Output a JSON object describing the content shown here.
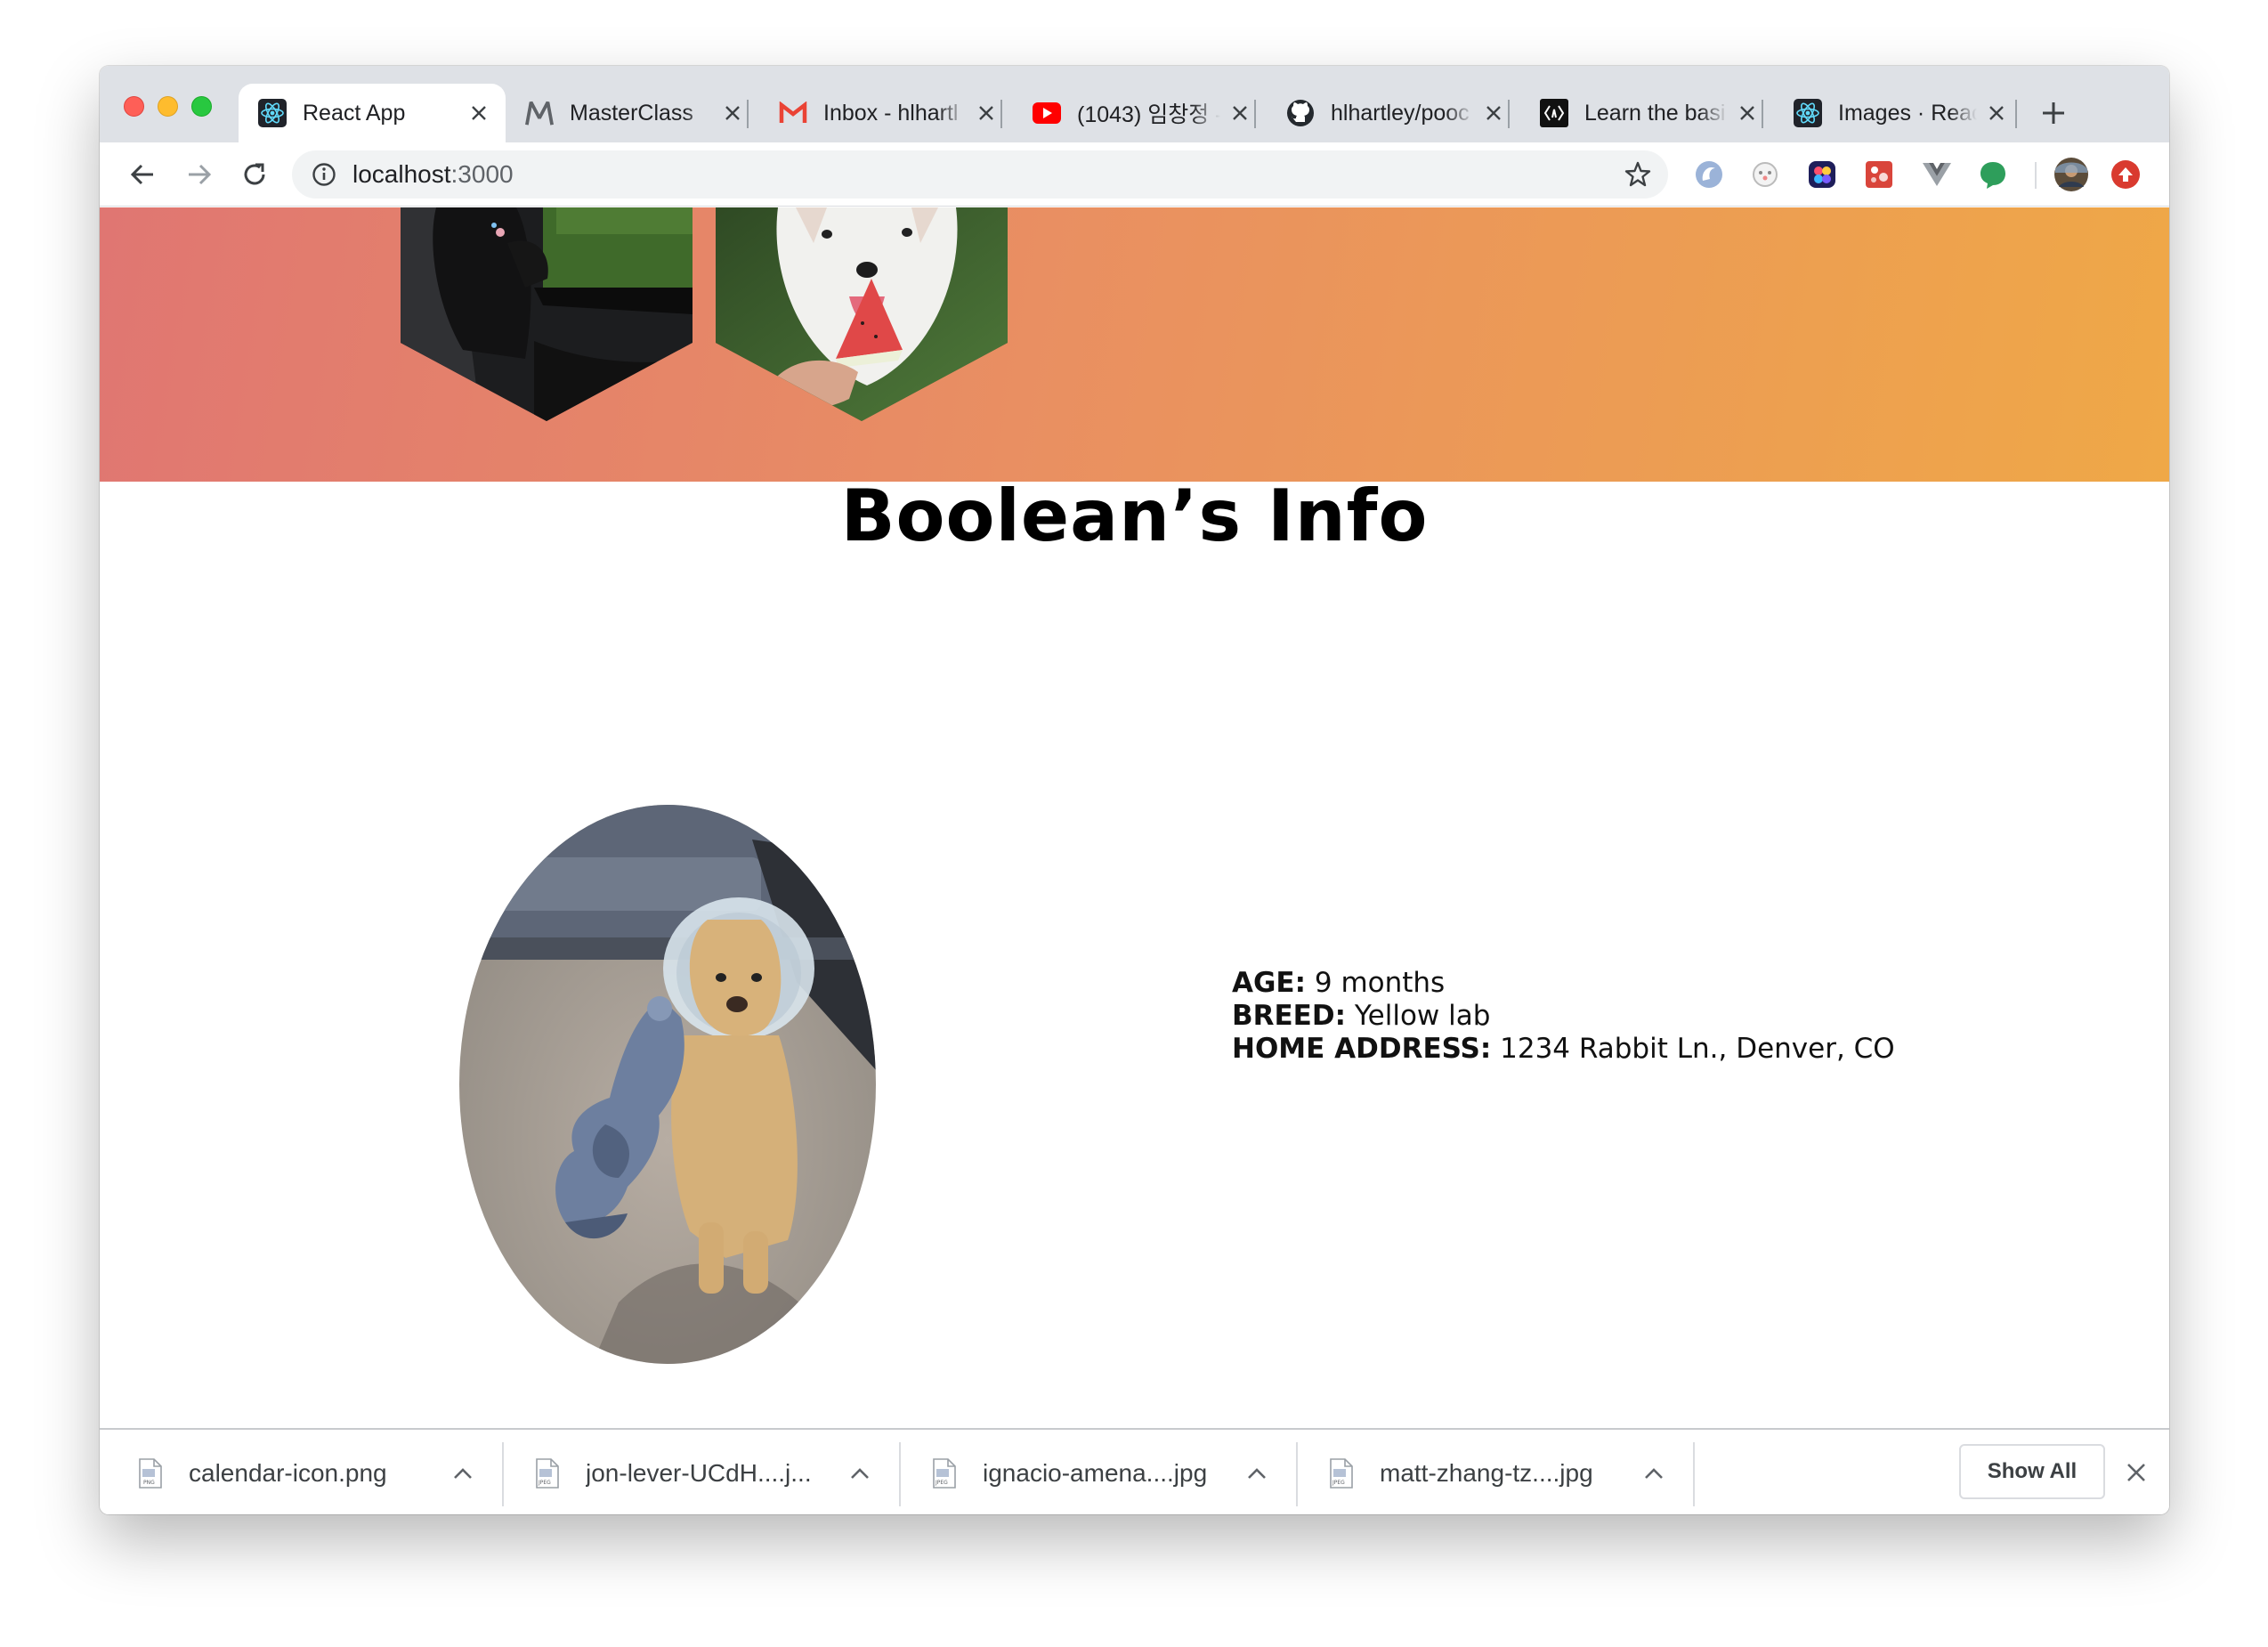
{
  "browser": {
    "tabs": [
      {
        "title": "React App",
        "icon": "react-icon",
        "active": true
      },
      {
        "title": "MasterClass",
        "icon": "masterclass-icon",
        "active": false
      },
      {
        "title": "Inbox - hlhartl",
        "icon": "gmail-icon",
        "active": false
      },
      {
        "title": "(1043) 임창정 -",
        "icon": "youtube-icon",
        "active": false
      },
      {
        "title": "hlhartley/pooc",
        "icon": "github-icon",
        "active": false
      },
      {
        "title": "Learn the basi",
        "icon": "codepen-icon",
        "active": false
      },
      {
        "title": "Images · React",
        "icon": "react-icon",
        "active": false
      }
    ],
    "url_host": "localhost",
    "url_port": ":3000",
    "extensions": [
      "edge-icon",
      "dogface-icon",
      "dots-icon",
      "puzzle-icon",
      "vue-icon",
      "chat-icon",
      "avatar",
      "upload-icon"
    ]
  },
  "page": {
    "title": "Boolean’s Info",
    "details": {
      "age_label": "AGE:",
      "age_value": " 9 months",
      "breed_label": "BREED:",
      "breed_value": " Yellow lab",
      "address_label": "HOME ADDRESS:",
      "address_value": " 1234 Rabbit Ln., Denver, CO"
    },
    "colors": {
      "gradient_start": "#e07672",
      "gradient_end": "#efa847"
    }
  },
  "downloads": {
    "items": [
      {
        "name": "calendar-icon.png",
        "type": "PNG"
      },
      {
        "name": "jon-lever-UCdH....j...",
        "type": "JPEG"
      },
      {
        "name": "ignacio-amena....jpg",
        "type": "JPEG"
      },
      {
        "name": "matt-zhang-tz....jpg",
        "type": "JPEG"
      }
    ],
    "show_all": "Show All"
  }
}
